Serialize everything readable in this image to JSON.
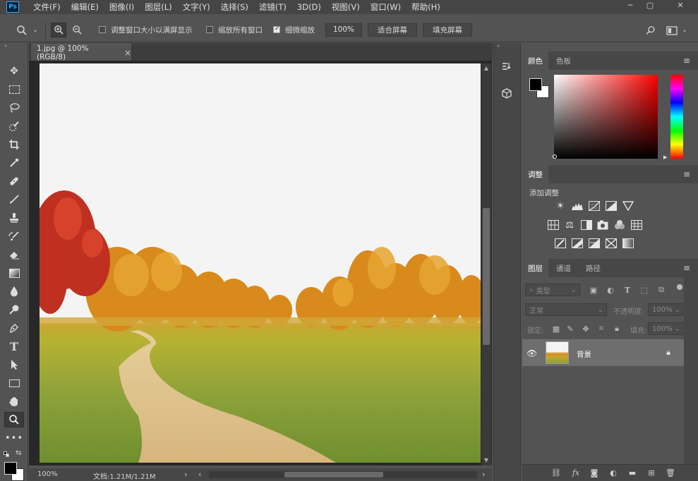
{
  "app": {
    "logo": "Ps"
  },
  "menu": [
    "文件(F)",
    "编辑(E)",
    "图像(I)",
    "图层(L)",
    "文字(Y)",
    "选择(S)",
    "滤镜(T)",
    "3D(D)",
    "视图(V)",
    "窗口(W)",
    "帮助(H)"
  ],
  "options": {
    "resize_windows_label": "调整窗口大小以满屏显示",
    "zoom_all_windows_label": "缩放所有窗口",
    "scrubby_zoom_label": "细微缩放",
    "zoom_value": "100%",
    "fit_screen_label": "适合屏幕",
    "fill_screen_label": "填充屏幕",
    "resize_windows_checked": false,
    "zoom_all_windows_checked": false,
    "scrubby_zoom_checked": true
  },
  "document": {
    "tab_title": "1.jpg @ 100%(RGB/8)",
    "close_icon": "×",
    "status_zoom": "100%",
    "status_doc": "文档:1.21M/1.21M"
  },
  "panels": {
    "color": {
      "tabs": [
        "颜色",
        "色板"
      ],
      "foreground": "#000000",
      "background": "#ffffff"
    },
    "adjustments": {
      "tab": "调整",
      "add_label": "添加调整"
    },
    "layers": {
      "tabs": [
        "图层",
        "通道",
        "路径"
      ],
      "filter_placeholder": "类型",
      "blend_mode": "正常",
      "opacity_label": "不透明度:",
      "opacity_value": "100%",
      "lock_label": "锁定:",
      "fill_label": "填充:",
      "fill_value": "100%",
      "items": [
        {
          "name": "背景",
          "visible": true,
          "locked": true
        }
      ]
    }
  },
  "colors": {
    "menubar": "#454545",
    "workspace": "#535353",
    "panel_header": "#474747",
    "accent": "#31a8ff"
  }
}
